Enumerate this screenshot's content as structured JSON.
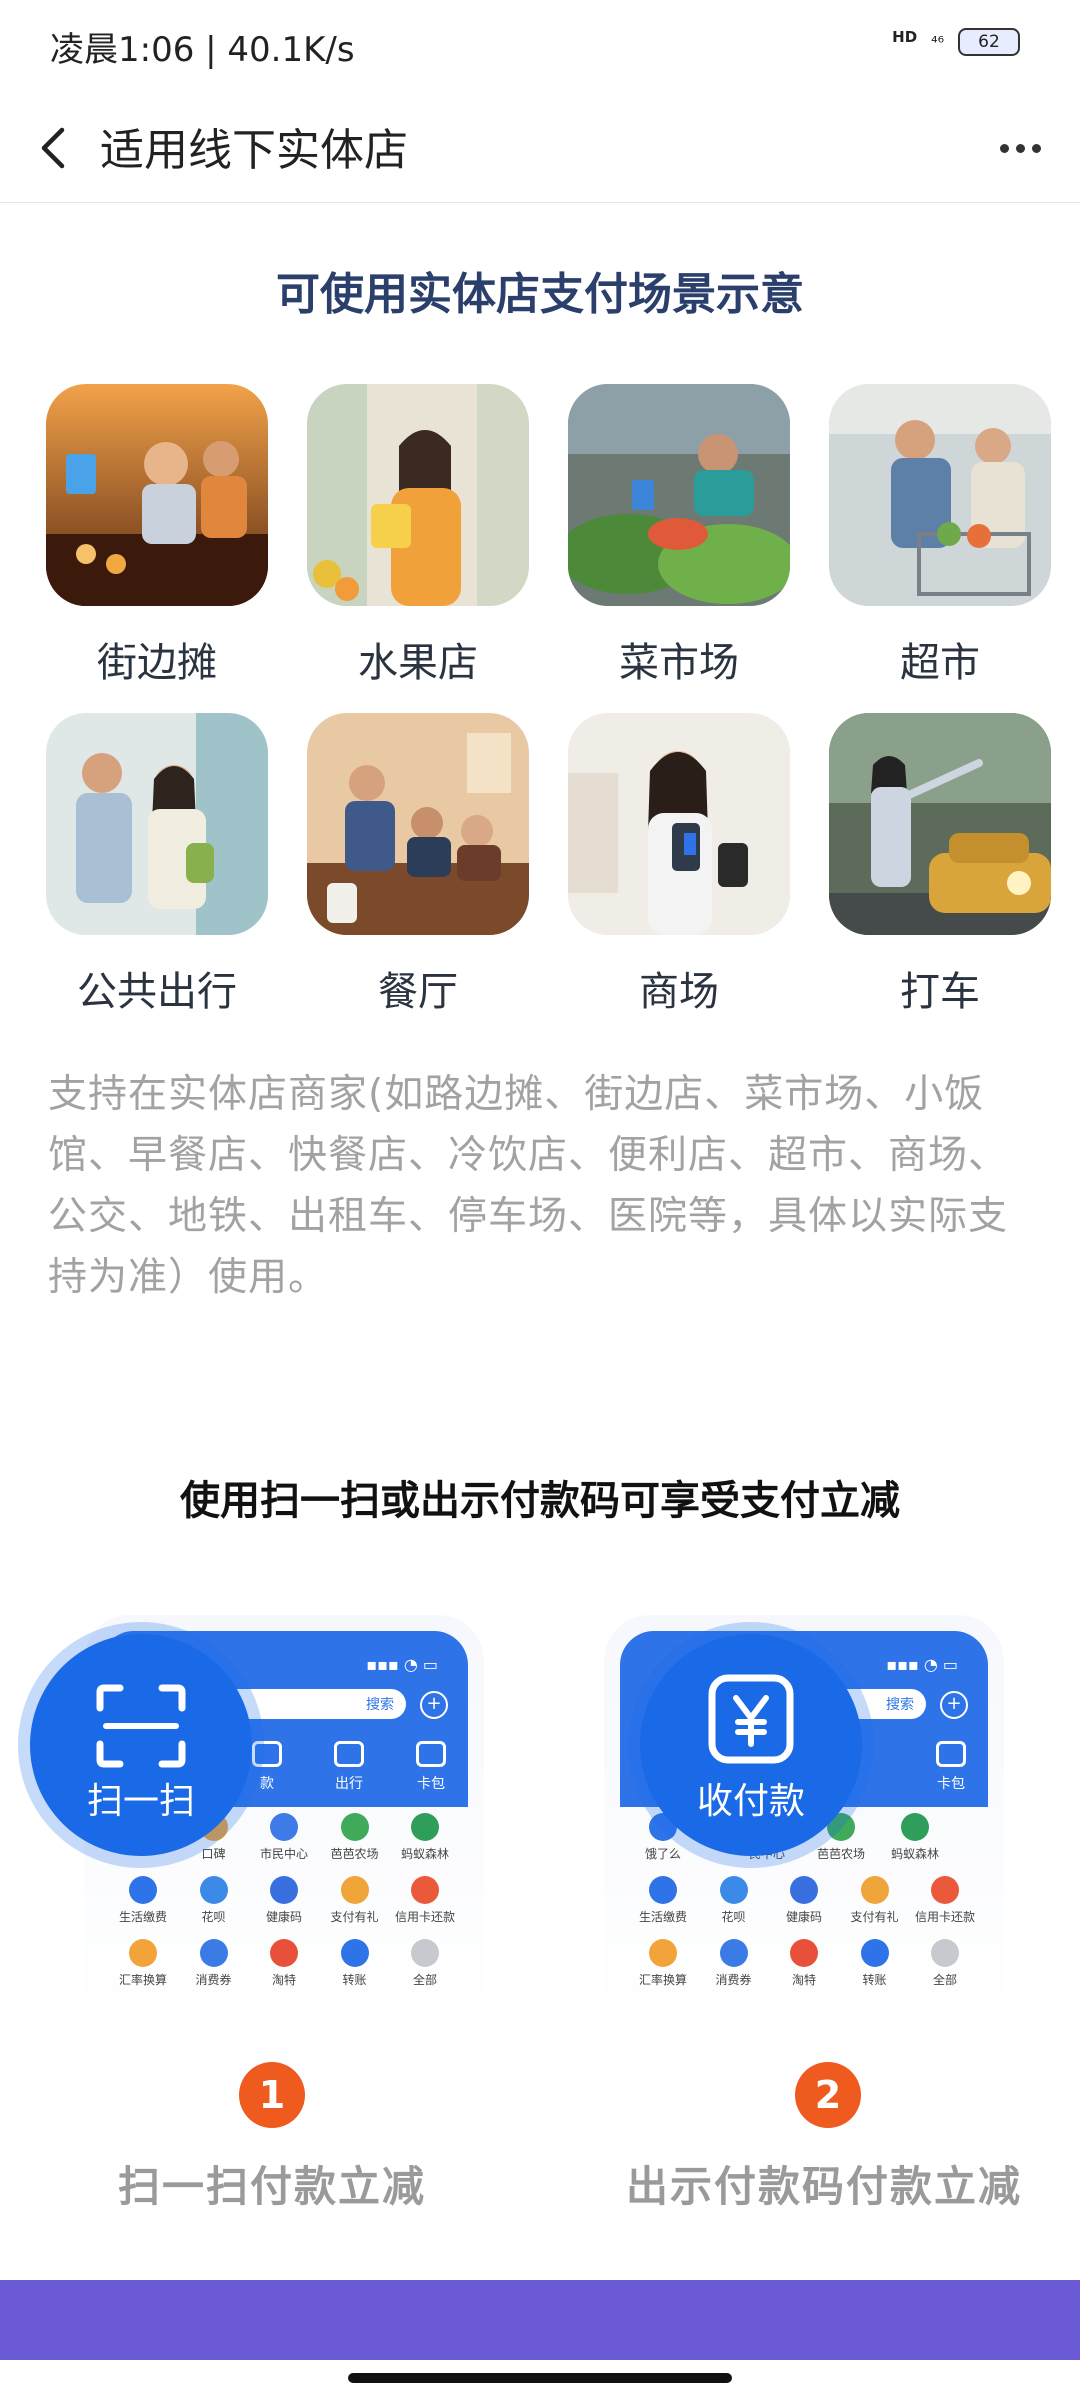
{
  "status_bar": {
    "time": "凌晨1:06 | 40.1K/s",
    "network": "HD",
    "signal": "⁴⁶",
    "battery": "62"
  },
  "nav": {
    "title": "适用线下实体店"
  },
  "section1": {
    "title": "可使用实体店支付场景示意",
    "scenes": [
      {
        "label": "街边摊"
      },
      {
        "label": "水果店"
      },
      {
        "label": "菜市场"
      },
      {
        "label": "超市"
      },
      {
        "label": "公共出行"
      },
      {
        "label": "餐厅"
      },
      {
        "label": "商场"
      },
      {
        "label": "打车"
      }
    ],
    "description": "支持在实体店商家(如路边摊、街边店、菜市场、小饭馆、早餐店、快餐店、冷饮店、便利店、超市、商场、公交、地铁、出租车、停车场、医院等，具体以实际支持为准）使用。"
  },
  "section2": {
    "title": "使用扫一扫或出示付款码可享受支付立减",
    "mock": {
      "search_label": "搜索",
      "status": "▪▪▪ ◔ ▭",
      "top_icons_left": [
        "款",
        "出行",
        "卡包"
      ],
      "top_icons_right": [
        "",
        "",
        "卡包"
      ],
      "apps_row1_left": [
        "",
        "口碑",
        "市民中心",
        "芭芭农场",
        "蚂蚁森林"
      ],
      "apps_row1_right": [
        "饿了么",
        "民中心",
        "芭芭农场",
        "蚂蚁森林"
      ],
      "apps_row2": [
        "生活缴费",
        "花呗",
        "健康码",
        "支付有礼",
        "信用卡还款"
      ],
      "apps_row3": [
        "汇率换算",
        "消费券",
        "淘特",
        "转账",
        "全部"
      ]
    },
    "steps": [
      {
        "num": "1",
        "badge": "扫一扫",
        "label": "扫一扫付款立减"
      },
      {
        "num": "2",
        "badge": "收付款",
        "label": "出示付款码付款立减"
      }
    ]
  }
}
